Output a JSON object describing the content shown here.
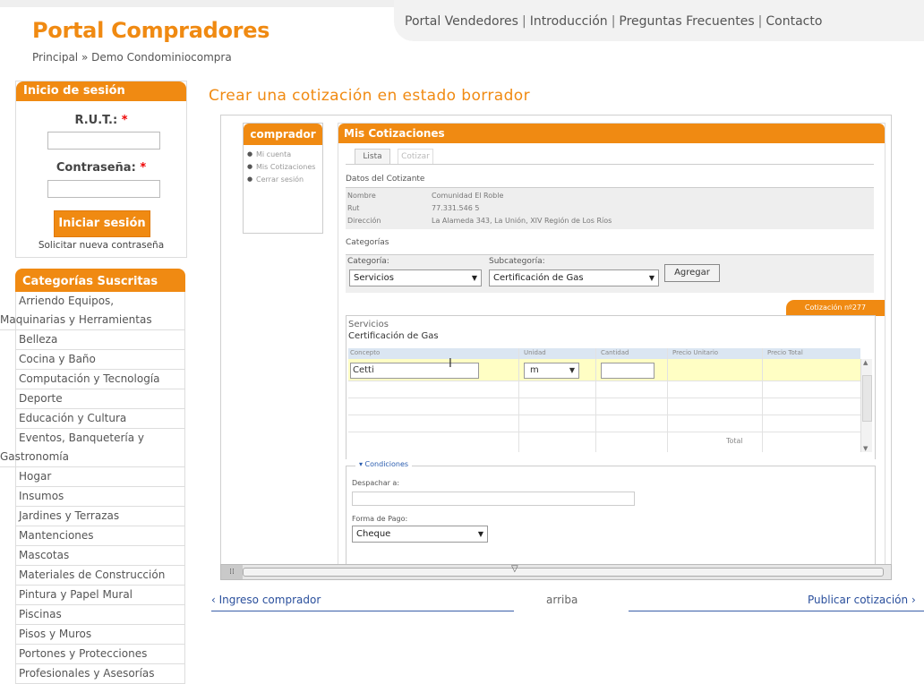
{
  "header": {
    "brand": "Portal Compradores",
    "breadcrumb": "Principal » Demo Condominiocompra",
    "nav": [
      "Portal Vendedores",
      "Introducción",
      "Preguntas Frecuentes",
      "Contacto"
    ]
  },
  "login": {
    "title": "Inicio de sesión",
    "rut_label": "R.U.T.:",
    "password_label": "Contraseña:",
    "required_mark": "*",
    "button": "Iniciar sesión",
    "forgot": "Solicitar nueva contraseña"
  },
  "categories": {
    "title": "Categorías Suscritas",
    "items": [
      "Arriendo Equipos,",
      "Maquinarias y Herramientas",
      "Belleza",
      "Cocina y Baño",
      "Computación y Tecnología",
      "Deporte",
      "Educación y Cultura",
      "Eventos, Banquetería y",
      "Gastronomía",
      "Hogar",
      "Insumos",
      "Jardines y Terrazas",
      "Mantenciones",
      "Mascotas",
      "Materiales de Construcción",
      "Pintura y Papel Mural",
      "Piscinas",
      "Pisos y Muros",
      "Portones y Protecciones",
      "Profesionales y Asesorías"
    ]
  },
  "main": {
    "title": "Crear una cotización en estado borrador",
    "comprador": {
      "title": "comprador",
      "links": [
        "Mi cuenta",
        "Mis Cotizaciones",
        "Cerrar sesión"
      ]
    },
    "cotizaciones": {
      "title": "Mis Cotizaciones",
      "tabs": [
        "Lista",
        "Cotizar"
      ],
      "datos_title": "Datos del Cotizante",
      "nombre_label": "Nombre",
      "nombre_value": "Comunidad El Roble",
      "rut_label": "Rut",
      "rut_value": "77.331.546 5",
      "direccion_label": "Dirección",
      "direccion_value": "La Alameda 343, La Unión, XIV Región de Los Ríos",
      "categorias_title": "Categorías",
      "categoria_label": "Categoría:",
      "categoria_value": "Servicios",
      "subcategoria_label": "Subcategoría:",
      "subcategoria_value": "Certificación de Gas",
      "add_button": "Agregar",
      "cotizacion_num": "Cotización nº277",
      "item_cat": "Servicios",
      "item_sub": "Certificación de Gas",
      "grid_headers": [
        "Concepto",
        "Unidad",
        "Cantidad",
        "Precio Unitario",
        "Precio Total"
      ],
      "concepto_value": "Cetti",
      "unidad_value": "m",
      "cantidad_value": "",
      "total_label": "Total",
      "condiciones_title": "▾ Condiciones",
      "despachar_label": "Despachar a:",
      "despachar_value": "",
      "forma_pago_label": "Forma de Pago:",
      "forma_pago_value": "Cheque"
    }
  },
  "footer": {
    "prev": "‹ Ingreso comprador",
    "top": "arriba",
    "next": "Publicar cotización ›"
  },
  "colors": {
    "accent": "#f08a12",
    "link": "#2a4f9c"
  }
}
